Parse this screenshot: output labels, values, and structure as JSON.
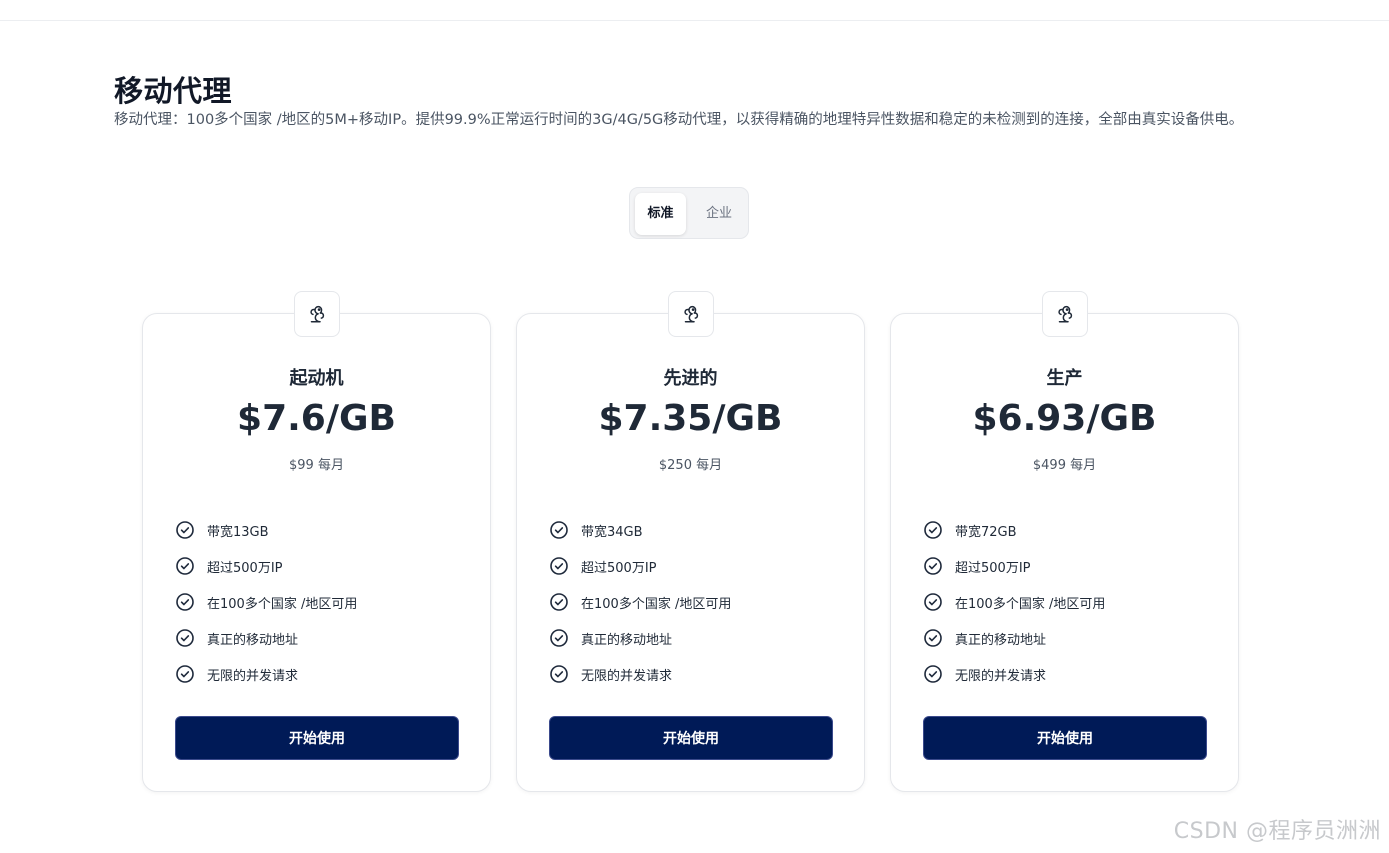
{
  "header": {
    "title": "移动代理",
    "description": "移动代理：100多个国家 /地区的5M+移动IP。提供99.9%正常运行时间的3G/4G/5G移动代理，以获得精确的地理特异性数据和稳定的未检测到的连接，全部由真实设备供电。"
  },
  "toggle": {
    "tabs": [
      {
        "label": "标准",
        "active": true
      },
      {
        "label": "企业",
        "active": false
      }
    ]
  },
  "plans": [
    {
      "icon": "squirrel-icon",
      "name": "起动机",
      "price": "$7.6/GB",
      "monthly": "$99 每月",
      "features": [
        "带宽13GB",
        "超过500万IP",
        "在100多个国家 /地区可用",
        "真正的移动地址",
        "无限的并发请求"
      ],
      "cta": "开始使用"
    },
    {
      "icon": "squirrel-icon",
      "name": "先进的",
      "price": "$7.35/GB",
      "monthly": "$250 每月",
      "features": [
        "带宽34GB",
        "超过500万IP",
        "在100多个国家 /地区可用",
        "真正的移动地址",
        "无限的并发请求"
      ],
      "cta": "开始使用"
    },
    {
      "icon": "squirrel-icon",
      "name": "生产",
      "price": "$6.93/GB",
      "monthly": "$499 每月",
      "features": [
        "带宽72GB",
        "超过500万IP",
        "在100多个国家 /地区可用",
        "真正的移动地址",
        "无限的并发请求"
      ],
      "cta": "开始使用"
    }
  ],
  "watermark": "CSDN @程序员洲洲",
  "colors": {
    "button_bg": "#001a57",
    "check_icon": "#1e293b",
    "title": "#111827"
  }
}
